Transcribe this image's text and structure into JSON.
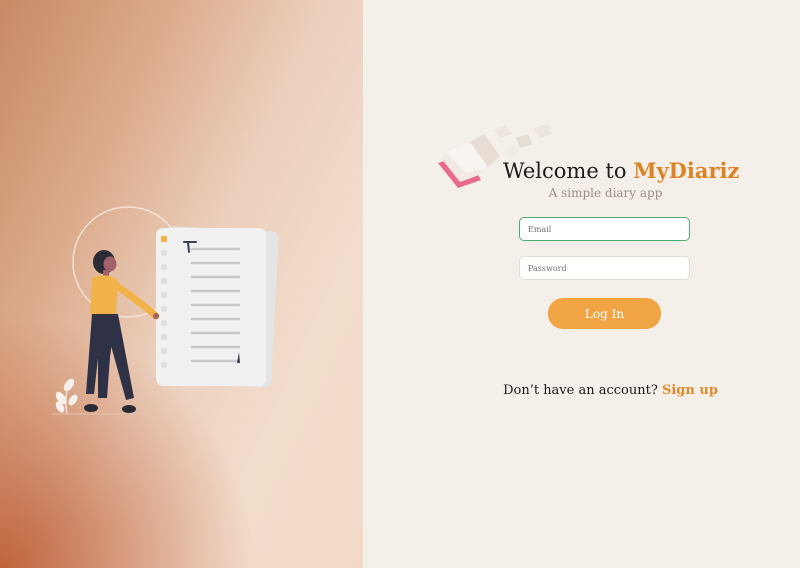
{
  "colors": {
    "accent": "#f0a444",
    "brand": "#dc8326",
    "link": "#e08a2c",
    "focus_border": "#4aae7a",
    "panel_bg": "#f5efe9"
  },
  "welcome": {
    "prefix": "Welcome to ",
    "brand": "MyDiariz",
    "subtitle": "A simple diary app"
  },
  "form": {
    "email_placeholder": "Email",
    "password_placeholder": "Password",
    "login_label": "Log In"
  },
  "signup": {
    "question": "Don’t have an account?",
    "link_label": "Sign up"
  },
  "icons": {
    "logo": "flying-book-icon",
    "illustration": "woman-with-checklist-illustration"
  }
}
